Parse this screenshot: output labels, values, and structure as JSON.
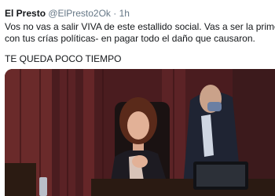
{
  "tweet": {
    "author_name": "El Presto",
    "author_handle": "@ElPresto2Ok",
    "separator": "·",
    "timestamp": "1h",
    "text_lines": [
      "Vos no vas a salir VIVA de este estallido social. Vas a ser la primera -j",
      "con tus crías políticas- en pagar todo el daño que causaron."
    ],
    "closing_line": "TE QUEDA POCO TIEMPO"
  },
  "colors": {
    "name": "#14171a",
    "meta": "#657786",
    "background": "#ffffff"
  }
}
